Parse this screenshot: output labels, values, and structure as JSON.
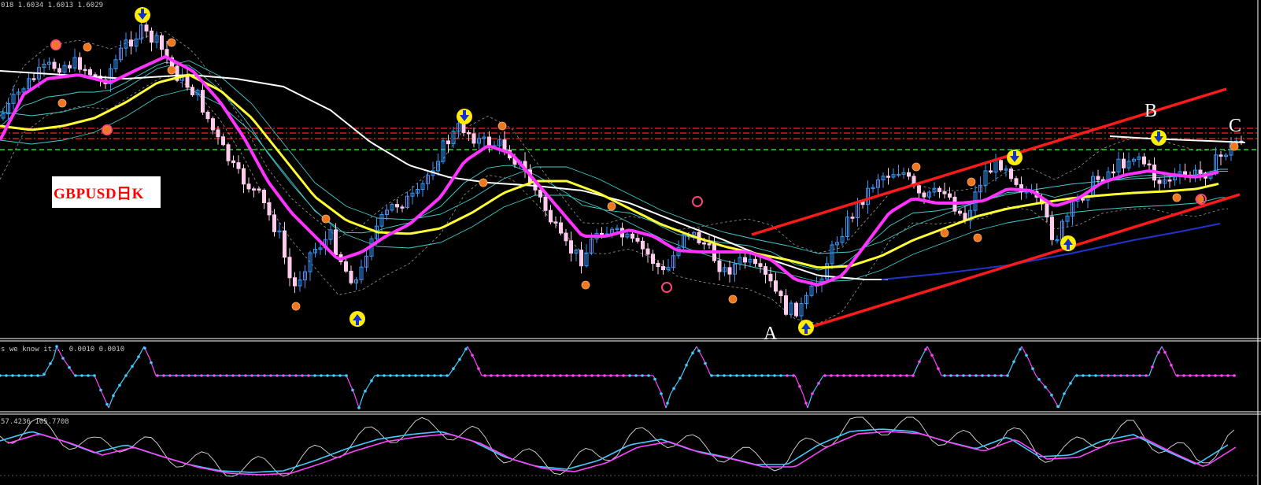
{
  "header": {
    "price_readout": "018 1.6034 1.6013 1.6029",
    "indicator1_readout": "s we know it... 0.0010 0.0010",
    "indicator2_readout": "57.4236 105.7708"
  },
  "symbol_label": "GBPUSD日K",
  "points": {
    "a": "A",
    "b": "B",
    "c": "C"
  },
  "colors": {
    "background": "#000000",
    "fast_ma": "#ff33ff",
    "slow_ma": "#ffff33",
    "long_ma": "#ffffff",
    "trend_ma": "#2233cc",
    "channel": "#ff1a1a",
    "bull_candle": "#3399ff",
    "bear_candle": "#ffccee",
    "signal_up": "#44ccff",
    "signal_down": "#ff44ff"
  },
  "icons": [
    "arrow-down-signal-icon",
    "arrow-up-signal-icon",
    "fractal-dot-icon"
  ]
}
